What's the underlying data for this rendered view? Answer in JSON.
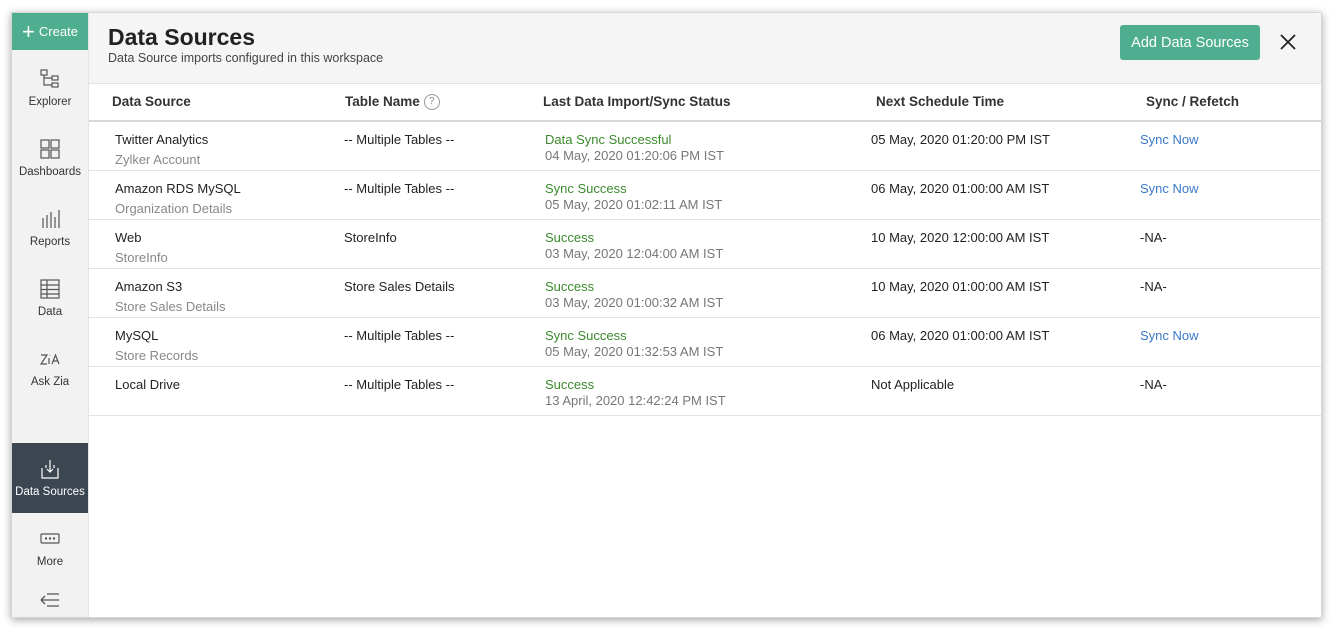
{
  "sidebar": {
    "create_label": "Create",
    "items": [
      {
        "label": "Explorer",
        "icon": "explorer-icon"
      },
      {
        "label": "Dashboards",
        "icon": "dashboards-icon"
      },
      {
        "label": "Reports",
        "icon": "reports-icon"
      },
      {
        "label": "Data",
        "icon": "data-table-icon"
      },
      {
        "label": "Ask Zia",
        "icon": "ask-zia-icon"
      },
      {
        "label": "Data Sources",
        "icon": "data-sources-icon",
        "active": true
      },
      {
        "label": "More",
        "icon": "more-icon"
      }
    ]
  },
  "header": {
    "title": "Data Sources",
    "subtitle": "Data Source imports configured in this workspace",
    "add_button": "Add Data Sources"
  },
  "table": {
    "columns": [
      "Data Source",
      "Table Name",
      "Last Data Import/Sync Status",
      "Next Schedule Time",
      "Sync / Refetch"
    ],
    "help_glyph": "?",
    "rows": [
      {
        "name": "Twitter Analytics",
        "sub": "Zylker Account",
        "table": "-- Multiple Tables --",
        "status": "Data Sync Successful",
        "time": "04 May, 2020 01:20:06 PM IST",
        "next": "05 May, 2020 01:20:00 PM IST",
        "sync": "Sync Now"
      },
      {
        "name": "Amazon RDS MySQL",
        "sub": "Organization Details",
        "table": "-- Multiple Tables --",
        "status": "Sync Success",
        "time": "05 May, 2020 01:02:11 AM IST",
        "next": "06 May, 2020 01:00:00 AM IST",
        "sync": "Sync Now"
      },
      {
        "name": "Web",
        "sub": "StoreInfo",
        "table": "StoreInfo",
        "status": "Success",
        "time": "03 May, 2020 12:04:00 AM IST",
        "next": "10 May, 2020 12:00:00 AM IST",
        "sync": "-NA-"
      },
      {
        "name": "Amazon S3",
        "sub": "Store Sales Details",
        "table": "Store Sales Details",
        "status": "Success",
        "time": "03 May, 2020 01:00:32 AM IST",
        "next": "10 May, 2020 01:00:00 AM IST",
        "sync": "-NA-"
      },
      {
        "name": "MySQL",
        "sub": "Store Records",
        "table": "-- Multiple Tables --",
        "status": "Sync Success",
        "time": "05 May, 2020 01:32:53 AM IST",
        "next": "06 May, 2020 01:00:00 AM IST",
        "sync": "Sync Now"
      },
      {
        "name": "Local Drive",
        "sub": "",
        "table": "-- Multiple Tables --",
        "status": "Success",
        "time": "13 April, 2020 12:42:24 PM IST",
        "next": "Not Applicable",
        "sync": "-NA-"
      }
    ]
  },
  "colors": {
    "accent": "#4fae8f",
    "active_nav": "#3b4650",
    "success_text": "#3c8a2e",
    "link": "#3b78c9"
  }
}
